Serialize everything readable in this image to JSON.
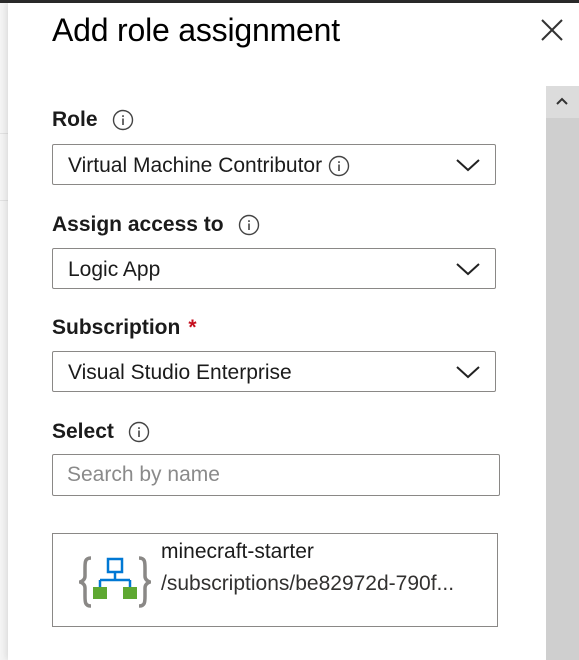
{
  "panel": {
    "title": "Add role assignment",
    "close_icon": "close-icon"
  },
  "role": {
    "label": "Role",
    "value": "Virtual Machine Contributor"
  },
  "assign_access": {
    "label": "Assign access to",
    "value": "Logic App"
  },
  "subscription": {
    "label": "Subscription",
    "required_marker": "*",
    "value": "Visual Studio Enterprise"
  },
  "select": {
    "label": "Select",
    "placeholder": "Search by name"
  },
  "result": {
    "name": "minecraft-starter",
    "path": "/subscriptions/be82972d-790f...",
    "icon": "logic-app-icon"
  },
  "colors": {
    "required": "#c50f1f",
    "border": "#8a8886",
    "logic_app_blue": "#0078d4",
    "logic_app_green": "#5ea832"
  }
}
